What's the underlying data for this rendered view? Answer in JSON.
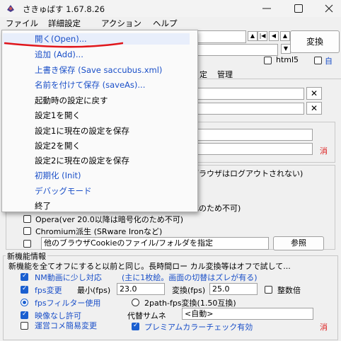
{
  "window": {
    "title": "さきゅばす 1.67.8.26",
    "icon": "app-icon",
    "controls": [
      "minimize-icon",
      "maximize-icon",
      "close-icon"
    ]
  },
  "menubar": [
    "ファイル",
    "詳細設定",
    "アクション",
    "ヘルプ"
  ],
  "file_menu": {
    "items": [
      {
        "label": "開く(Open)...",
        "style": "blue"
      },
      {
        "label": "追加 (Add)...",
        "style": "blue"
      },
      {
        "label": "上書き保存 (Save saccubus.xml)",
        "style": "blue"
      },
      {
        "label": "名前を付けて保存 (saveAs)...",
        "style": "blue"
      },
      {
        "label": "起動時の設定に戻す",
        "style": "black"
      },
      {
        "label": "設定1を開く",
        "style": "black"
      },
      {
        "label": "設定1に現在の設定を保存",
        "style": "black"
      },
      {
        "label": "設定2を開く",
        "style": "black"
      },
      {
        "label": "設定2に現在の設定を保存",
        "style": "black"
      },
      {
        "label": "初期化 (Init)",
        "style": "blue"
      },
      {
        "label": "デバッグモード",
        "style": "blue"
      },
      {
        "label": "終了",
        "style": "black"
      }
    ]
  },
  "top": {
    "convert_button": "変換",
    "html5_label": "html5",
    "auto_label": "自",
    "tabs": [
      "定",
      "管理"
    ],
    "x_buttons": [
      "✕",
      "✕"
    ],
    "red_mark": "消",
    "partial_browser": "ブラウザはログアウトされない)",
    "partial_cipher": "化のため不可)"
  },
  "browser_options": [
    "Opera(ver 20.0以降は暗号化のため不可)",
    "Chromium派生 (SRware Ironなど)"
  ],
  "cookie_path": {
    "placeholder": "他のブラウザCookieのファイル/フォルダを指定",
    "browse_button": "参照"
  },
  "new_features": {
    "group_title": "新機能情報",
    "description": "新機能を全てオフにすると以前と同じ。長時間ロー カル変換等はオフで試して...",
    "nm_label": "NM動画に少し対応",
    "nm_note": "(主に1枚絵。画面の切替はズレが有る)",
    "fps_change_label": "fps変更",
    "min_fps_label": "最小(fps)",
    "min_fps_value": "23.0",
    "convert_fps_label": "変換(fps)",
    "convert_fps_value": "25.0",
    "integer_label": "整数倍",
    "fps_filter_label": "fpsフィルター使用",
    "two_path_label": "2path-fps変換(1.50互換)",
    "no_video_label": "映像なし許可",
    "thumb_label": "代替サムネ",
    "thumb_value": "<自動>",
    "admin_comment_label": "運営コメ簡易変更",
    "premium_label": "プレミアムカラーチェック有効",
    "red_mark": "消"
  }
}
